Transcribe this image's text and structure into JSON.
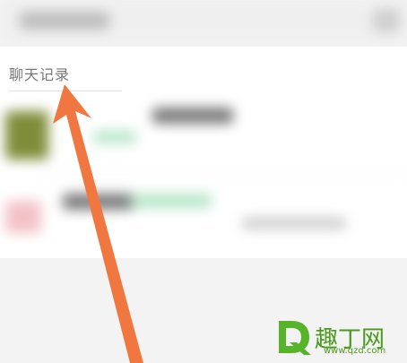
{
  "section": {
    "title": "聊天记录"
  },
  "watermark": {
    "brand": "趣丁网",
    "url": "www.qzd.com"
  }
}
